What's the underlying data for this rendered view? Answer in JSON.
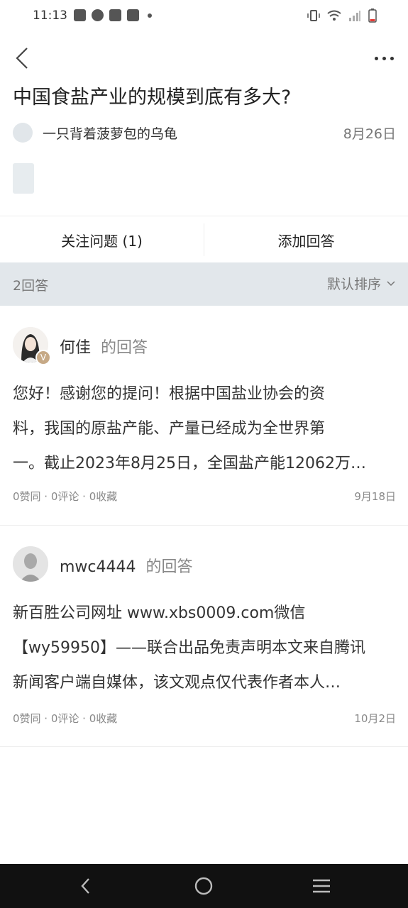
{
  "status_bar": {
    "time": "11:13"
  },
  "question": {
    "title": "中国食盐产业的规模到底有多大?",
    "author": "一只背着菠萝包的乌龟",
    "date": "8月26日"
  },
  "actions": {
    "follow_label": "关注问题 (1)",
    "add_answer_label": "添加回答"
  },
  "answers_header": {
    "count_label": "2回答",
    "sort_label": "默认排序"
  },
  "answers": [
    {
      "author": "何佳",
      "suffix": "的回答",
      "lines": [
        "您好！感谢您的提问！根据中国盐业协会的资",
        "料，我国的原盐产能、产量已经成为全世界第",
        "一。截止2023年8月25日，全国盐产能12062万…"
      ],
      "stats": "0赞同 · 0评论 · 0收藏",
      "date": "9月18日",
      "badge": "V"
    },
    {
      "author": "mwc4444",
      "suffix": "的回答",
      "lines": [
        "新百胜公司网址 www.xbs0009.com微信",
        "【wy59950】——联合出品免责声明本文来自腾讯",
        "新闻客户端自媒体，该文观点仅代表作者本人…"
      ],
      "stats": "0赞同 · 0评论 · 0收藏",
      "date": "10月2日"
    }
  ]
}
